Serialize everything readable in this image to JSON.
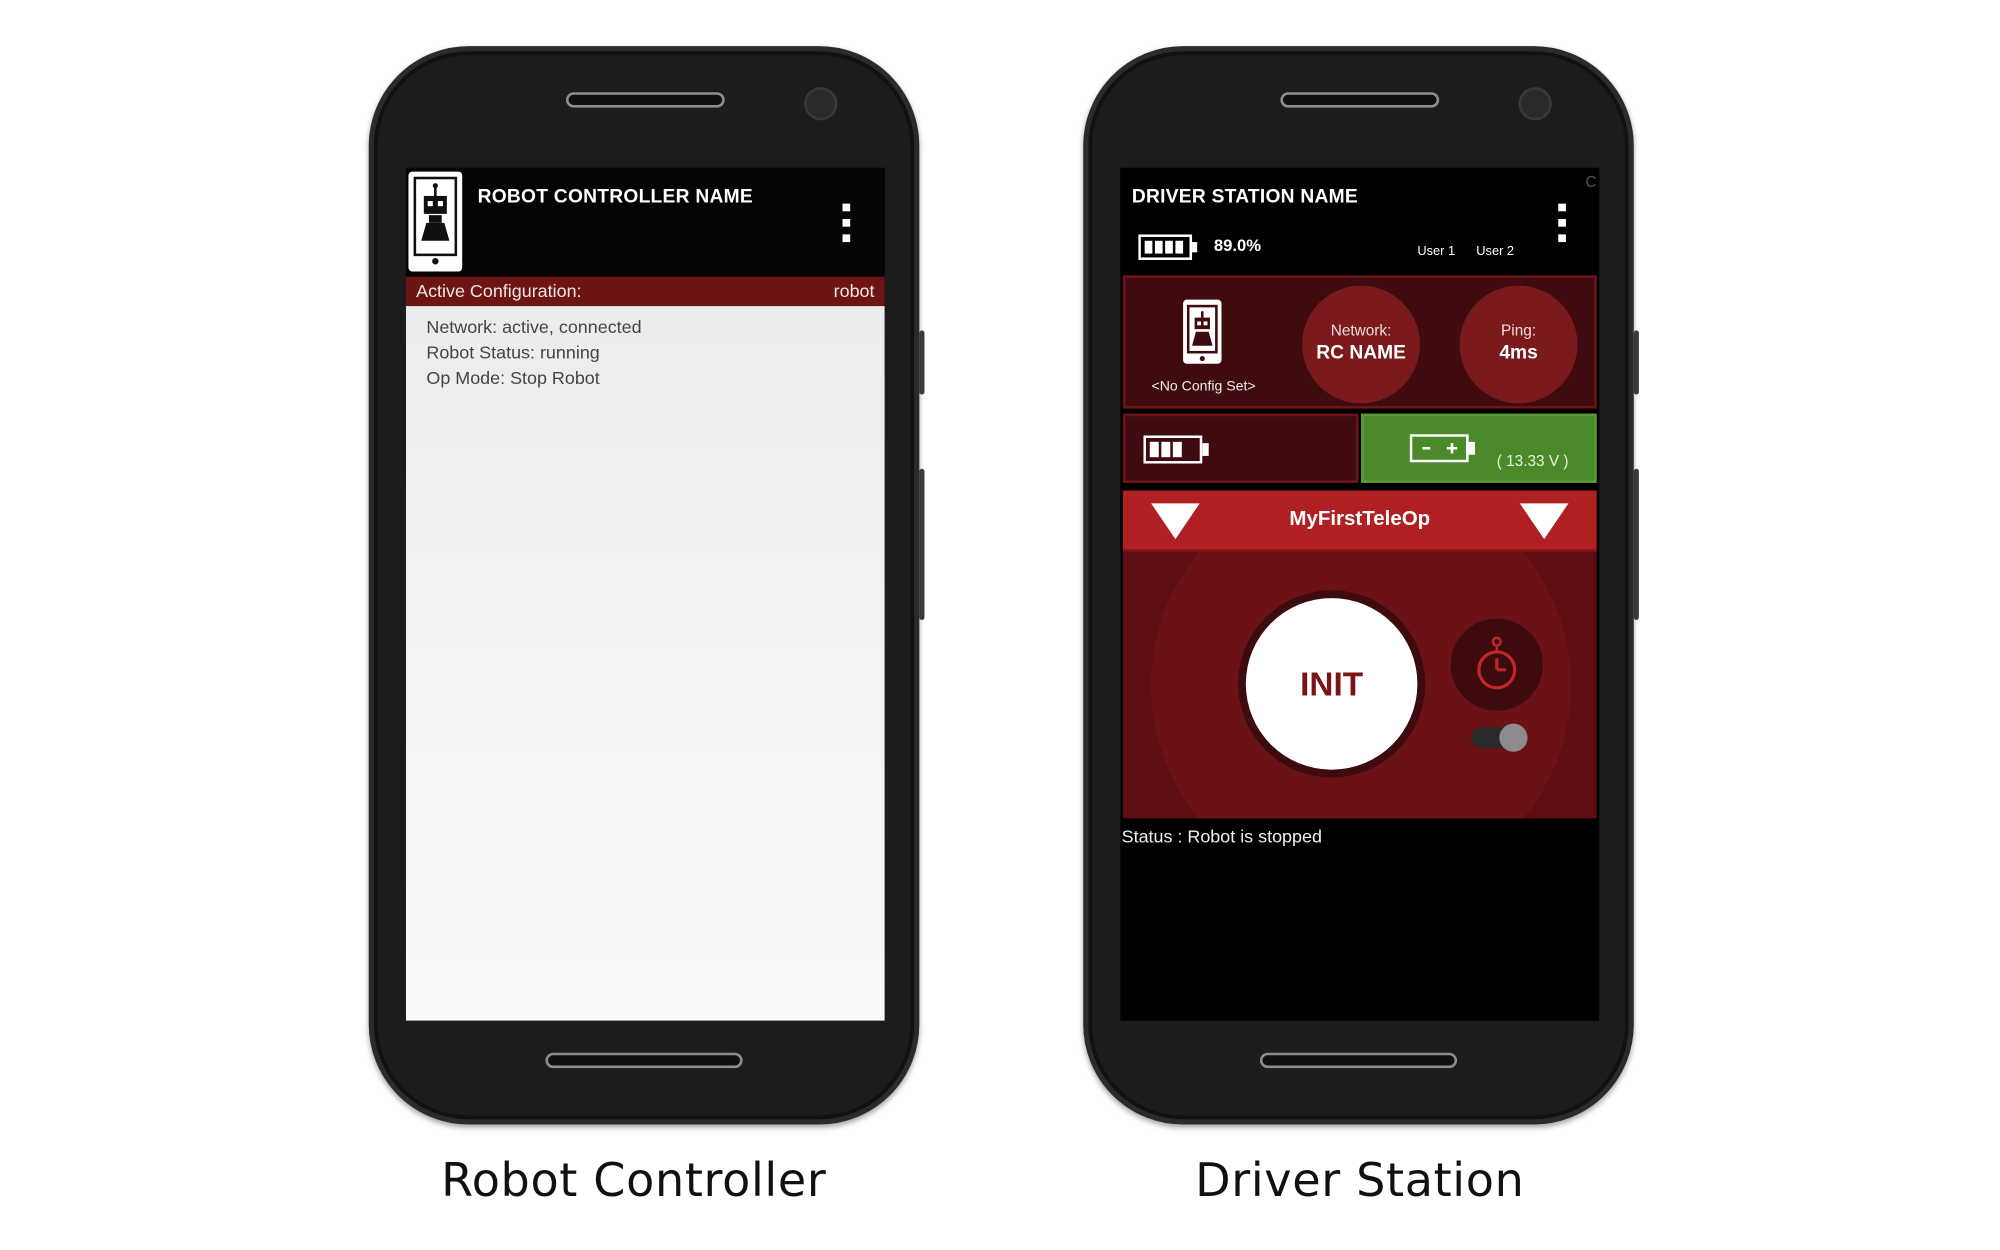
{
  "robot_controller": {
    "header_title": "ROBOT CONTROLLER NAME",
    "active_configuration_label": "Active Configuration:",
    "active_configuration_value": "robot",
    "status_lines": [
      "Network: active, connected",
      "Robot Status: running",
      "Op Mode: Stop Robot"
    ],
    "caption": "Robot Controller"
  },
  "driver_station": {
    "header_title": "DRIVER STATION NAME",
    "phone_battery": "89.0%",
    "users": [
      "User 1",
      "User 2"
    ],
    "corner_char": "C",
    "config_text": "<No Config Set>",
    "network_label": "Network:",
    "network_value": "RC NAME",
    "ping_label": "Ping:",
    "ping_value": "4ms",
    "robot_voltage": "( 13.33 V )",
    "op_mode": "MyFirstTeleOp",
    "init_label": "INIT",
    "status": "Status : Robot is stopped",
    "caption": "Driver Station"
  },
  "colors": {
    "dark_red": "#6d1414",
    "panel_red": "#3f0b0e",
    "circle_red": "#7a1a1d",
    "opmode_red": "#b01f22",
    "battery_green": "#4a8a2a"
  },
  "icons": [
    "robot-controller-logo-icon",
    "menu-overflow-icon",
    "phone-battery-icon",
    "robot-phone-icon",
    "battery-icon",
    "robot-battery-icon",
    "dropdown-triangle-icon",
    "stopwatch-icon"
  ]
}
